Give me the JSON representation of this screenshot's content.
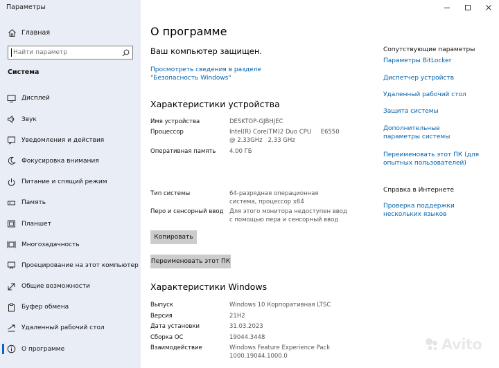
{
  "window": {
    "title": "Параметры",
    "controls": [
      "minimize",
      "maximize",
      "close"
    ]
  },
  "sidebar": {
    "home_label": "Главная",
    "search_placeholder": "Найти параметр",
    "section_label": "Система",
    "items": [
      {
        "label": "Дисплей",
        "icon": "display-icon"
      },
      {
        "label": "Звук",
        "icon": "speaker-icon"
      },
      {
        "label": "Уведомления и действия",
        "icon": "notifications-icon"
      },
      {
        "label": "Фокусировка внимания",
        "icon": "moon-icon"
      },
      {
        "label": "Питание и спящий режим",
        "icon": "power-icon"
      },
      {
        "label": "Память",
        "icon": "storage-icon"
      },
      {
        "label": "Планшет",
        "icon": "tablet-icon"
      },
      {
        "label": "Многозадачность",
        "icon": "multitasking-icon"
      },
      {
        "label": "Проецирование на этот компьютер",
        "icon": "projection-icon"
      },
      {
        "label": "Общие возможности",
        "icon": "shared-experiences-icon"
      },
      {
        "label": "Буфер обмена",
        "icon": "clipboard-icon"
      },
      {
        "label": "Удаленный рабочий стол",
        "icon": "remote-desktop-icon"
      },
      {
        "label": "О программе",
        "icon": "info-icon",
        "active": true
      }
    ]
  },
  "main": {
    "title": "О программе",
    "protected_text": "Ваш компьютер защищен.",
    "security_link": "Просмотреть сведения в разделе \"Безопасность Windows\"",
    "device_specs": {
      "heading": "Характеристики устройства",
      "rows": [
        {
          "key": "Имя устройства",
          "value": "DESKTOP-GJBHJEC"
        },
        {
          "key": "Процессор",
          "value": "Intel(R) Core(TM)2 Duo CPU     E6550  @ 2.33GHz   2.33 GHz"
        },
        {
          "key": "Оперативная память",
          "value": "4.00 ГБ"
        },
        {
          "key": "Тип системы",
          "value": "64-разрядная операционная система, процессор x64"
        },
        {
          "key": "Перо и сенсорный ввод",
          "value": "Для этого монитора недоступен ввод с помощью пера и сенсорный ввод"
        }
      ]
    },
    "copy_button": "Копировать",
    "rename_button": "Переименовать этот ПК",
    "windows_specs": {
      "heading": "Характеристики Windows",
      "rows": [
        {
          "key": "Выпуск",
          "value": "Windows 10 Корпоративная LTSC"
        },
        {
          "key": "Версия",
          "value": "21H2"
        },
        {
          "key": "Дата установки",
          "value": "31.03.2023"
        },
        {
          "key": "Сборка ОС",
          "value": "19044.3448"
        },
        {
          "key": "Взаимодействие",
          "value": "Windows Feature Experience Pack 1000.19044.1000.0"
        }
      ]
    }
  },
  "related": {
    "heading": "Сопутствующие параметры",
    "links": [
      "Параметры BitLocker",
      "Диспетчер устройств",
      "Удаленный рабочий стол",
      "Защита системы",
      "Дополнительные параметры системы",
      "Переименовать этот ПК (для опытных пользователей)"
    ],
    "help_heading": "Справка в Интернете",
    "help_links": [
      "Проверка поддержки нескольких языков"
    ]
  },
  "watermark": {
    "text": "Avito"
  }
}
